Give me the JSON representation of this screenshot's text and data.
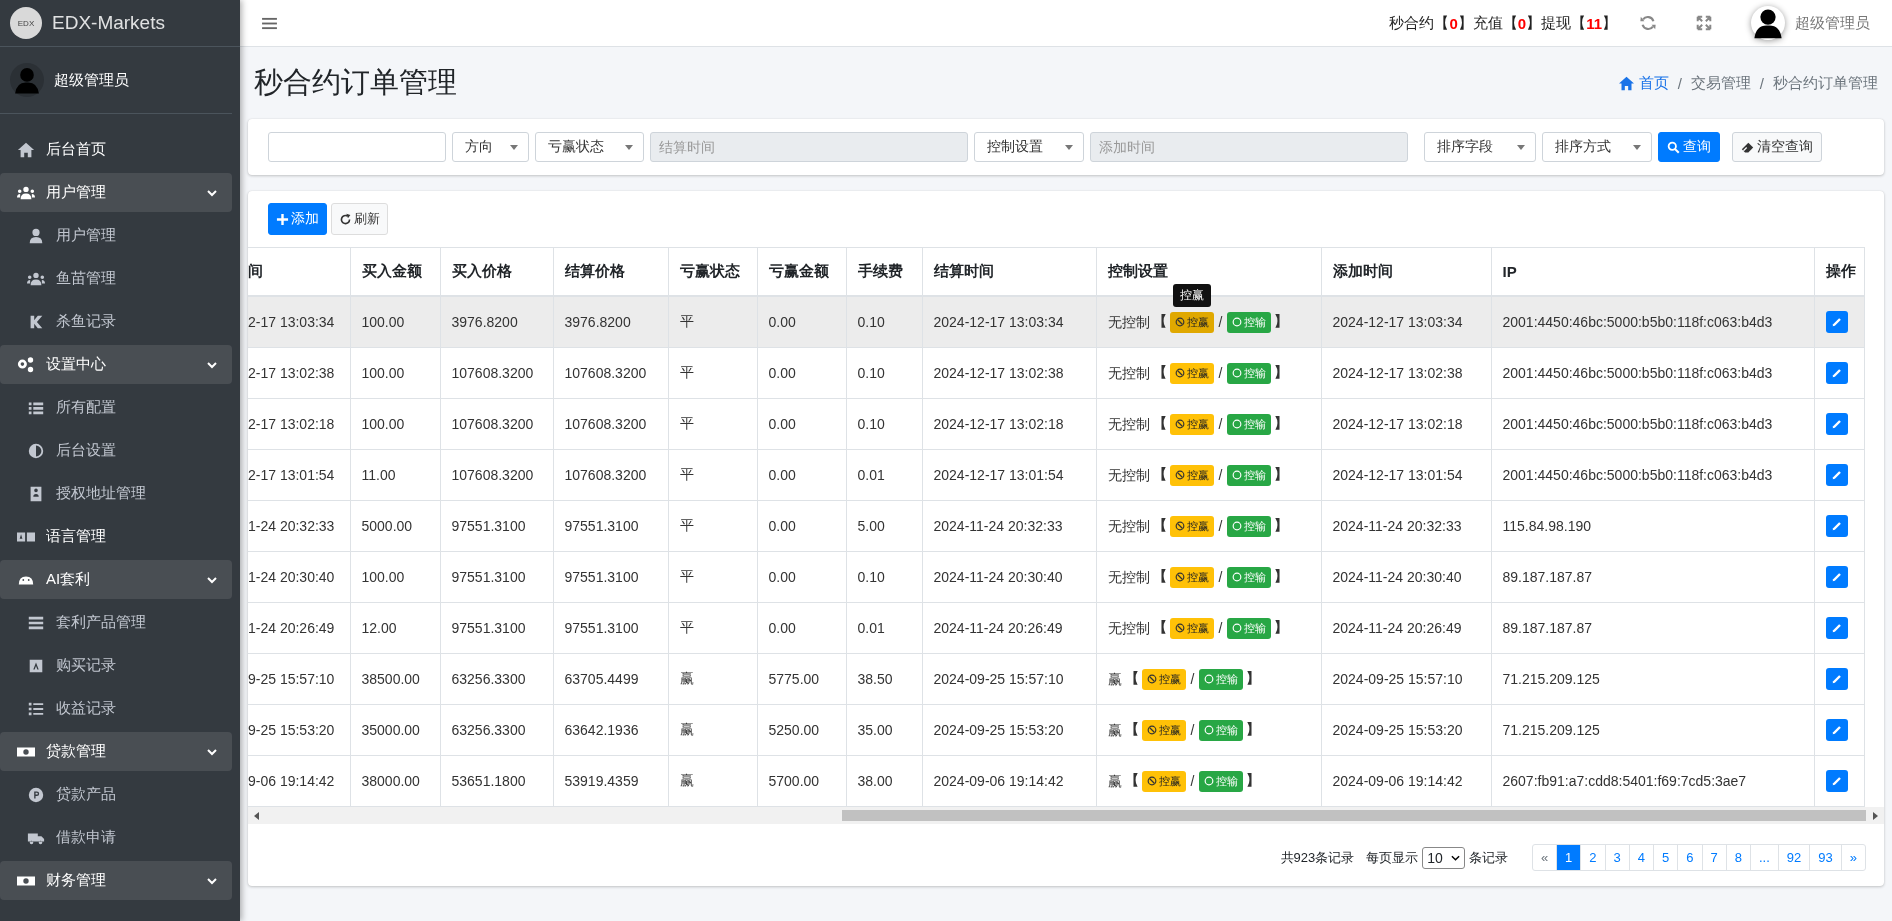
{
  "brand": {
    "logo": "EDX",
    "name": "EDX-Markets"
  },
  "sidebar": {
    "user": "超级管理员",
    "items": [
      {
        "label": "后台首页",
        "selected": false
      },
      {
        "label": "用户管理",
        "expanded": true,
        "children": [
          {
            "label": "用户管理",
            "selected": false
          },
          {
            "label": "鱼苗管理",
            "selected": false
          },
          {
            "label": "杀鱼记录",
            "selected": false
          }
        ]
      },
      {
        "label": "设置中心",
        "expanded": true,
        "children": [
          {
            "label": "所有配置",
            "selected": false
          },
          {
            "label": "后台设置",
            "selected": false
          },
          {
            "label": "授权地址管理",
            "selected": false
          }
        ]
      },
      {
        "label": "语言管理",
        "selected": false
      },
      {
        "label": "AI套利",
        "expanded": true,
        "children": [
          {
            "label": "套利产品管理",
            "selected": false
          },
          {
            "label": "购买记录",
            "selected": false
          },
          {
            "label": "收益记录",
            "selected": false
          }
        ]
      },
      {
        "label": "贷款管理",
        "expanded": true,
        "children": [
          {
            "label": "贷款产品",
            "selected": false
          },
          {
            "label": "借款申请",
            "selected": false
          }
        ]
      },
      {
        "label": "财务管理",
        "expanded": true
      }
    ]
  },
  "topbar": {
    "notices": [
      {
        "label": "秒合约",
        "open": "【",
        "count": "0",
        "close": "】"
      },
      {
        "label": "充值",
        "open": "【",
        "count": "0",
        "close": "】"
      },
      {
        "label": "提现",
        "open": "【",
        "count": "11",
        "close": "】"
      }
    ],
    "user": "超级管理员"
  },
  "page": {
    "title": "秒合约订单管理",
    "breadcrumb": [
      {
        "kind": "link",
        "text": "首页"
      },
      {
        "kind": "sep",
        "text": "/"
      },
      {
        "kind": "text",
        "text": "交易管理"
      },
      {
        "kind": "sep",
        "text": "/"
      },
      {
        "kind": "text",
        "text": "秒合约订单管理"
      }
    ]
  },
  "filters": [
    {
      "kind": "input"
    },
    {
      "kind": "select",
      "label": "方向"
    },
    {
      "kind": "select",
      "label": "亏赢状态"
    },
    {
      "kind": "date",
      "placeholder": "结算时间"
    },
    {
      "kind": "select",
      "label": "控制设置"
    },
    {
      "kind": "date",
      "placeholder": "添加时间"
    },
    {
      "kind": "select",
      "label": "排序字段"
    },
    {
      "kind": "select",
      "label": "排序方式"
    },
    {
      "kind": "primary",
      "label": "查询"
    },
    {
      "kind": "clear",
      "label": "清空查询"
    }
  ],
  "toolbar": {
    "add": "添加",
    "refresh": "刷新"
  },
  "table": {
    "columns": [
      "间",
      "买入金额",
      "买入价格",
      "结算价格",
      "亏赢状态",
      "亏赢金额",
      "手续费",
      "结算时间",
      "控制设置",
      "添加时间",
      "IP",
      "操作"
    ],
    "rows": [
      {
        "hovered": true,
        "cells": [
          "2-17 13:03:34",
          "100.00",
          "3976.8200",
          "3976.8200",
          "平",
          "0.00",
          "0.10",
          "2024-12-17 13:03:34"
        ],
        "control": {
          "status": "无控制",
          "open": "【",
          "win": "控赢",
          "sep": "/",
          "lose": "控输",
          "close": "】",
          "tooltip": "控赢"
        },
        "added": "2024-12-17 13:03:34",
        "ip": "2001:4450:46bc:5000:b5b0:118f:c063:b4d3"
      },
      {
        "hovered": false,
        "cells": [
          "2-17 13:02:38",
          "100.00",
          "107608.3200",
          "107608.3200",
          "平",
          "0.00",
          "0.10",
          "2024-12-17 13:02:38"
        ],
        "control": {
          "status": "无控制",
          "open": "【",
          "win": "控赢",
          "sep": "/",
          "lose": "控输",
          "close": "】"
        },
        "added": "2024-12-17 13:02:38",
        "ip": "2001:4450:46bc:5000:b5b0:118f:c063:b4d3"
      },
      {
        "hovered": false,
        "cells": [
          "2-17 13:02:18",
          "100.00",
          "107608.3200",
          "107608.3200",
          "平",
          "0.00",
          "0.10",
          "2024-12-17 13:02:18"
        ],
        "control": {
          "status": "无控制",
          "open": "【",
          "win": "控赢",
          "sep": "/",
          "lose": "控输",
          "close": "】"
        },
        "added": "2024-12-17 13:02:18",
        "ip": "2001:4450:46bc:5000:b5b0:118f:c063:b4d3"
      },
      {
        "hovered": false,
        "cells": [
          "2-17 13:01:54",
          "11.00",
          "107608.3200",
          "107608.3200",
          "平",
          "0.00",
          "0.01",
          "2024-12-17 13:01:54"
        ],
        "control": {
          "status": "无控制",
          "open": "【",
          "win": "控赢",
          "sep": "/",
          "lose": "控输",
          "close": "】"
        },
        "added": "2024-12-17 13:01:54",
        "ip": "2001:4450:46bc:5000:b5b0:118f:c063:b4d3"
      },
      {
        "hovered": false,
        "cells": [
          "1-24 20:32:33",
          "5000.00",
          "97551.3100",
          "97551.3100",
          "平",
          "0.00",
          "5.00",
          "2024-11-24 20:32:33"
        ],
        "control": {
          "status": "无控制",
          "open": "【",
          "win": "控赢",
          "sep": "/",
          "lose": "控输",
          "close": "】"
        },
        "added": "2024-11-24 20:32:33",
        "ip": "115.84.98.190"
      },
      {
        "hovered": false,
        "cells": [
          "1-24 20:30:40",
          "100.00",
          "97551.3100",
          "97551.3100",
          "平",
          "0.00",
          "0.10",
          "2024-11-24 20:30:40"
        ],
        "control": {
          "status": "无控制",
          "open": "【",
          "win": "控赢",
          "sep": "/",
          "lose": "控输",
          "close": "】"
        },
        "added": "2024-11-24 20:30:40",
        "ip": "89.187.187.87"
      },
      {
        "hovered": false,
        "cells": [
          "1-24 20:26:49",
          "12.00",
          "97551.3100",
          "97551.3100",
          "平",
          "0.00",
          "0.01",
          "2024-11-24 20:26:49"
        ],
        "control": {
          "status": "无控制",
          "open": "【",
          "win": "控赢",
          "sep": "/",
          "lose": "控输",
          "close": "】"
        },
        "added": "2024-11-24 20:26:49",
        "ip": "89.187.187.87"
      },
      {
        "hovered": false,
        "cells": [
          "9-25 15:57:10",
          "38500.00",
          "63256.3300",
          "63705.4499",
          "赢",
          "5775.00",
          "38.50",
          "2024-09-25 15:57:10"
        ],
        "control": {
          "status": "赢",
          "open": "【",
          "win": "控赢",
          "sep": "/",
          "lose": "控输",
          "close": "】"
        },
        "added": "2024-09-25 15:57:10",
        "ip": "71.215.209.125"
      },
      {
        "hovered": false,
        "cells": [
          "9-25 15:53:20",
          "35000.00",
          "63256.3300",
          "63642.1936",
          "赢",
          "5250.00",
          "35.00",
          "2024-09-25 15:53:20"
        ],
        "control": {
          "status": "赢",
          "open": "【",
          "win": "控赢",
          "sep": "/",
          "lose": "控输",
          "close": "】"
        },
        "added": "2024-09-25 15:53:20",
        "ip": "71.215.209.125"
      },
      {
        "hovered": false,
        "cells": [
          "9-06 19:14:42",
          "38000.00",
          "53651.1800",
          "53919.4359",
          "赢",
          "5700.00",
          "38.00",
          "2024-09-06 19:14:42"
        ],
        "control": {
          "status": "赢",
          "open": "【",
          "win": "控赢",
          "sep": "/",
          "lose": "控输",
          "close": "】"
        },
        "added": "2024-09-06 19:14:42",
        "ip": "2607:fb91:a7:cdd8:5401:f69:7cd5:3ae7"
      }
    ]
  },
  "pagination": {
    "total": "共923条记录",
    "per_page_label": "每页显示",
    "per_page": "10",
    "per_page_suffix": "条记录",
    "pages": [
      {
        "label": "«",
        "selected": false
      },
      {
        "label": "1",
        "selected": true
      },
      {
        "label": "2",
        "selected": false
      },
      {
        "label": "3",
        "selected": false
      },
      {
        "label": "4",
        "selected": false
      },
      {
        "label": "5",
        "selected": false
      },
      {
        "label": "6",
        "selected": false
      },
      {
        "label": "7",
        "selected": false
      },
      {
        "label": "8",
        "selected": false
      },
      {
        "label": "...",
        "selected": false
      },
      {
        "label": "92",
        "selected": false
      },
      {
        "label": "93",
        "selected": false
      },
      {
        "label": "»",
        "selected": false
      }
    ]
  }
}
